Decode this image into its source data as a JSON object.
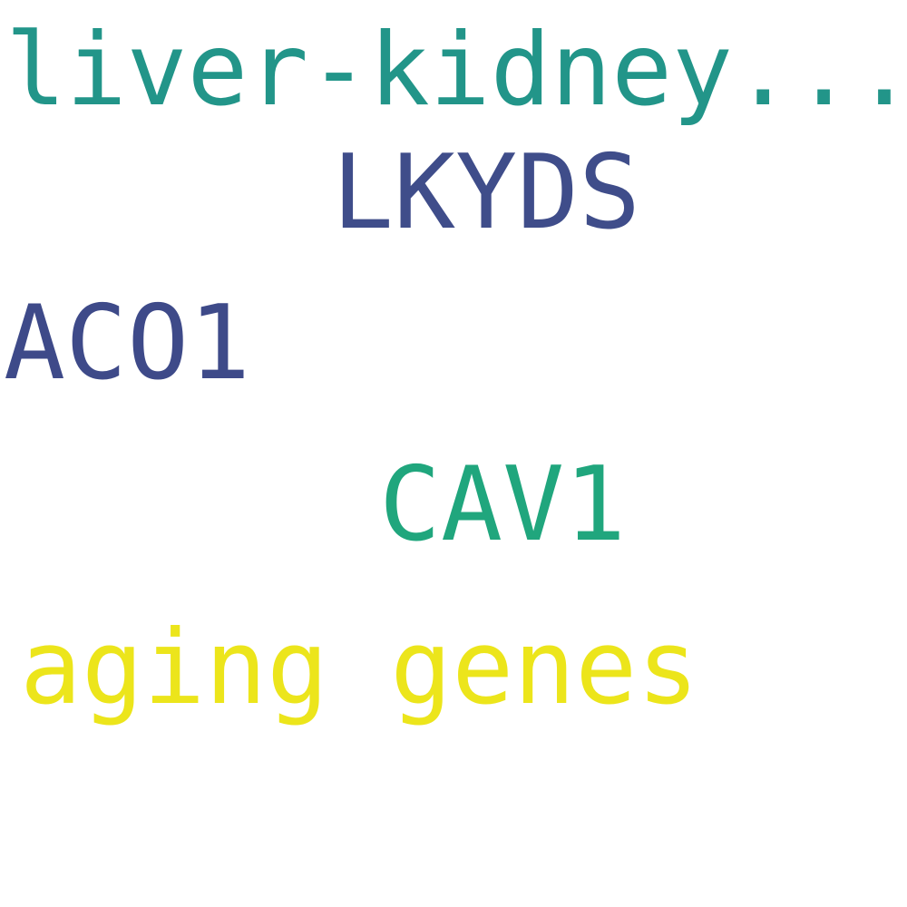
{
  "words": [
    {
      "text": "liver-kidney...",
      "color": "#229589"
    },
    {
      "text": "LKYDS",
      "color": "#3f4d8a"
    },
    {
      "text": "ACO1",
      "color": "#3e4a89"
    },
    {
      "text": "CAV1",
      "color": "#20a67d"
    },
    {
      "text": "aging genes",
      "color": "#ece51b"
    }
  ]
}
